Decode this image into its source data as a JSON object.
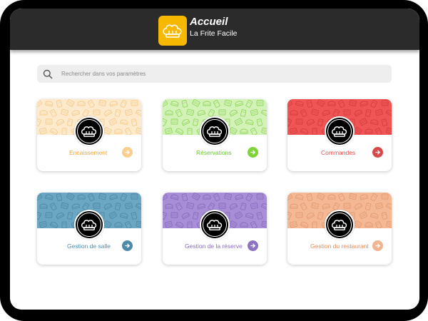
{
  "header": {
    "title": "Accueil",
    "subtitle": "La Frite Facile",
    "logo_icon": "chef-hat-icon",
    "logo_color": "#f6b800"
  },
  "search": {
    "placeholder": "Rechercher dans vos paramètres",
    "icon": "search-icon"
  },
  "cards": [
    {
      "label": "Encaissement",
      "color": "#f2a43a",
      "bg": "#fdeacc",
      "pattern": "#f6c98a",
      "arrow_bg": "#f8cf8f",
      "icon": "chef-hat-icon"
    },
    {
      "label": "Réservations",
      "color": "#66c928",
      "bg": "#d3f2b8",
      "pattern": "#8fd65a",
      "arrow_bg": "#7ed437",
      "icon": "chef-hat-icon"
    },
    {
      "label": "Commandes",
      "color": "#e24b4b",
      "bg": "#f05555",
      "pattern": "#d63c3c",
      "arrow_bg": "#d94848",
      "icon": "chef-hat-icon"
    },
    {
      "label": "Gestion de salle",
      "color": "#4a90b0",
      "bg": "#6ba6c2",
      "pattern": "#4d88a6",
      "arrow_bg": "#4d8aa8",
      "icon": "chef-hat-icon"
    },
    {
      "label": "Gestion de la réserve",
      "color": "#8a6cc0",
      "bg": "#a88ed6",
      "pattern": "#876cbf",
      "arrow_bg": "#8d73c2",
      "icon": "chef-hat-icon"
    },
    {
      "label": "Gestion du restaurant",
      "color": "#e38d5c",
      "bg": "#f4b895",
      "pattern": "#e39a70",
      "arrow_bg": "#f1b48f",
      "icon": "chef-hat-icon"
    }
  ]
}
